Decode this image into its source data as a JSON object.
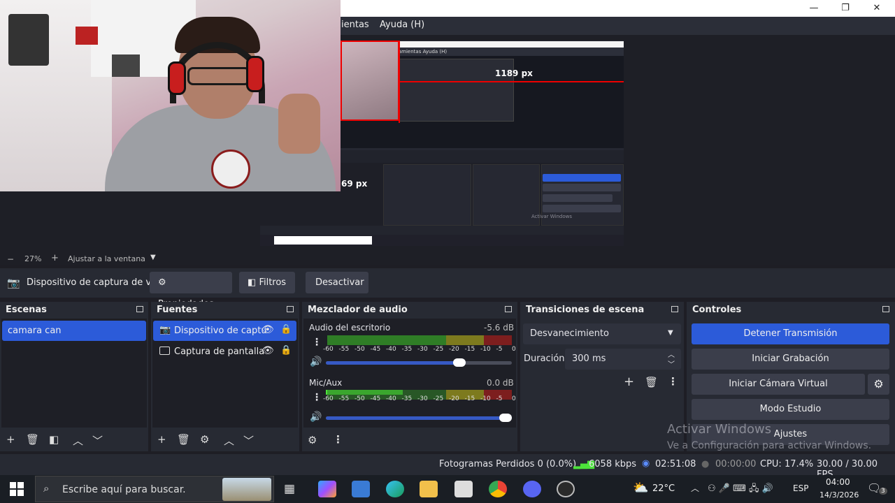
{
  "menu": {
    "partial_item": "ientas",
    "help": "Ayuda (H)"
  },
  "preview": {
    "measure_label": "1189 px",
    "measure_label_2": "69 px",
    "inner_menu": "ramientas  Ayuda (H)",
    "inner_watermark": "Activar Windows"
  },
  "zoom": {
    "minus": "−",
    "value": "27%",
    "plus": "+",
    "fit": "Ajustar a la ventana"
  },
  "source_bar": {
    "selected_source": "Dispositivo de captura de v",
    "properties": "Propiedades",
    "filters": "Filtros",
    "deactivate": "Desactivar"
  },
  "scenes": {
    "title": "Escenas",
    "items": [
      "camara can"
    ]
  },
  "sources": {
    "title": "Fuentes",
    "items": [
      "Dispositivo de captu",
      "Captura de pantalla"
    ]
  },
  "mixer": {
    "title": "Mezclador de audio",
    "channels": [
      {
        "name": "Audio del escritorio",
        "db": "-5.6 dB",
        "volume": 0.75
      },
      {
        "name": "Mic/Aux",
        "db": "0.0 dB",
        "volume": 1.0
      }
    ],
    "scale": [
      "-60",
      "-55",
      "-50",
      "-45",
      "-40",
      "-35",
      "-30",
      "-25",
      "-20",
      "-15",
      "-10",
      "-5",
      "0"
    ]
  },
  "transitions": {
    "title": "Transiciones de escena",
    "selected": "Desvanecimiento",
    "duration_label": "Duración",
    "duration_value": "300 ms"
  },
  "controls": {
    "title": "Controles",
    "stop_stream": "Detener Transmisión",
    "start_recording": "Iniciar Grabación",
    "start_virtual_cam": "Iniciar Cámara Virtual",
    "studio_mode": "Modo Estudio",
    "settings": "Ajustes"
  },
  "status": {
    "dropped_frames": "Fotogramas Perdidos 0 (0.0%)",
    "bitrate": "6058 kbps",
    "stream_time": "02:51:08",
    "rec_time": "00:00:00",
    "cpu": "CPU: 17.4%",
    "fps": "30.00 / 30.00 FPS"
  },
  "watermark": {
    "line1": "Activar Windows",
    "line2": "Ve a Configuración para activar Windows."
  },
  "taskbar": {
    "search_placeholder": "Escribe aquí para buscar.",
    "temperature": "22°C",
    "language": "ESP",
    "time": "04:00",
    "date": "14/3/2026",
    "notifications": "3"
  },
  "colors": {
    "accent": "#2c5bd9",
    "panel": "#272a33",
    "background": "#1e1f26"
  }
}
